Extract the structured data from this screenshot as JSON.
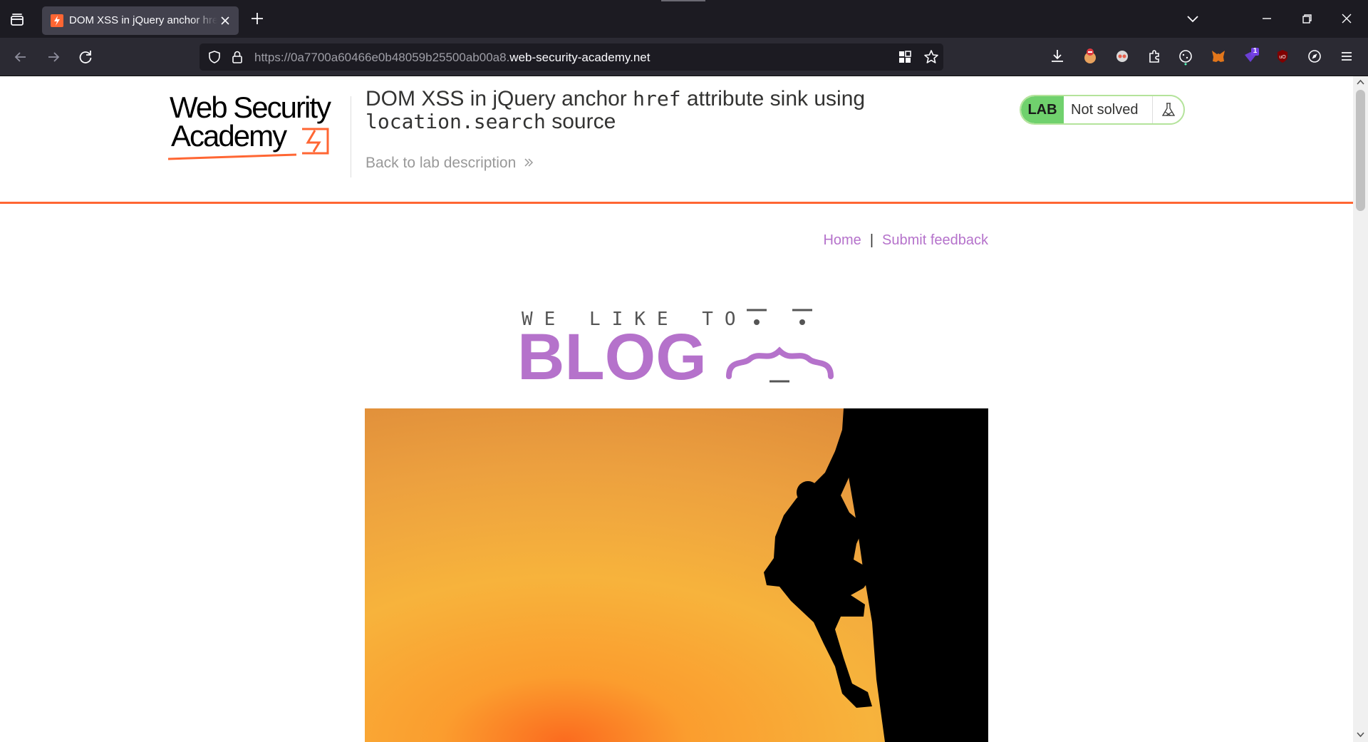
{
  "browser": {
    "tab": {
      "title": "DOM XSS in jQuery anchor href attribute sink using location.search source"
    },
    "url": {
      "prefix": "https://0a7700a60466e0b48059b25500ab00a8.",
      "domain": "web-security-academy.net"
    },
    "extensions": [
      "download-icon",
      "ublock-like-icon",
      "ghostery-icon",
      "extensions-puzzle-icon",
      "cookie-icon",
      "metamask-fox-icon",
      "notification-extension-icon",
      "ublock-origin-icon",
      "compass-icon",
      "menu-icon"
    ],
    "extension_badge": "1"
  },
  "header": {
    "logo_line1": "Web Security",
    "logo_line2": "Academy",
    "lab_title_part1": "DOM XSS in jQuery anchor",
    "lab_title_code1": "href",
    "lab_title_part2": "attribute sink using",
    "lab_title_code2": "location.search",
    "lab_title_part3": "source",
    "back_link": "Back to lab description",
    "status": {
      "badge": "LAB",
      "text": "Not solved"
    }
  },
  "nav": {
    "home": "Home",
    "separator": "|",
    "feedback": "Submit feedback"
  },
  "banner": {
    "line1": "WE LIKE TO",
    "line2": "BLOG"
  },
  "colors": {
    "accent_orange": "#ff6633",
    "link_purple": "#b572cb",
    "lab_green": "#70d16d"
  }
}
